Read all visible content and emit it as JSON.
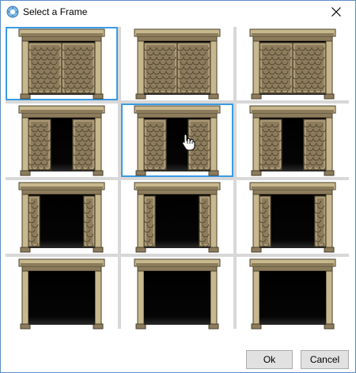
{
  "dialog": {
    "title": "Select a Frame",
    "icon": "app-icon",
    "close_icon": "close-icon"
  },
  "frames": [
    {
      "open": 0,
      "selected": true
    },
    {
      "open": 0,
      "selected": false
    },
    {
      "open": 0,
      "selected": false
    },
    {
      "open": 0.33,
      "selected": false
    },
    {
      "open": 0.33,
      "selected": true
    },
    {
      "open": 0.33,
      "selected": false
    },
    {
      "open": 0.66,
      "selected": false
    },
    {
      "open": 0.66,
      "selected": false
    },
    {
      "open": 0.66,
      "selected": false
    },
    {
      "open": 1,
      "selected": false
    },
    {
      "open": 1,
      "selected": false
    },
    {
      "open": 1,
      "selected": false
    }
  ],
  "buttons": {
    "ok": "Ok",
    "cancel": "Cancel"
  },
  "colors": {
    "selection": "#3a9be5",
    "grid_line": "#d8d8d8",
    "stone": "#8c7c5c",
    "stone_light": "#c8b88e",
    "stone_dark": "#4a3f2b"
  },
  "cursor": "hand-pointer-icon"
}
